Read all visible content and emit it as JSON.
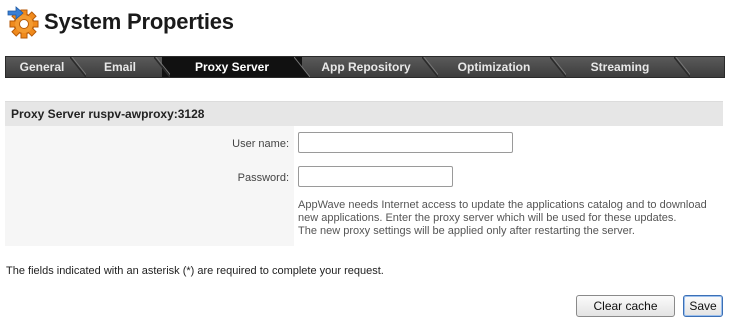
{
  "header": {
    "title": "System Properties",
    "icon": "settings-gear-icon"
  },
  "tabs": [
    {
      "label": "General",
      "active": false
    },
    {
      "label": "Email",
      "active": false
    },
    {
      "label": "Proxy Server",
      "active": true
    },
    {
      "label": "App Repository",
      "active": false
    },
    {
      "label": "Optimization",
      "active": false
    },
    {
      "label": "Streaming",
      "active": false
    }
  ],
  "panel": {
    "title": "Proxy Server ruspv-awproxy:3128",
    "username": {
      "label": "User name:",
      "value": ""
    },
    "password": {
      "label": "Password:",
      "value": ""
    },
    "help": [
      "AppWave needs Internet access to update the applications catalog and to download",
      "new applications. Enter the proxy server which will be used for these updates.",
      "The new proxy settings will be applied only after restarting the server."
    ]
  },
  "footer": {
    "required_note": "The fields indicated with an asterisk (*) are required to complete your request.",
    "clear_cache_label": "Clear cache",
    "save_label": "Save"
  },
  "colors": {
    "tabbar": "#4a4a4a",
    "active_tab": "#111111",
    "panel_bg": "#f6f6f6",
    "panel_head": "#e6e6e6",
    "gear": "#f08a1c"
  }
}
